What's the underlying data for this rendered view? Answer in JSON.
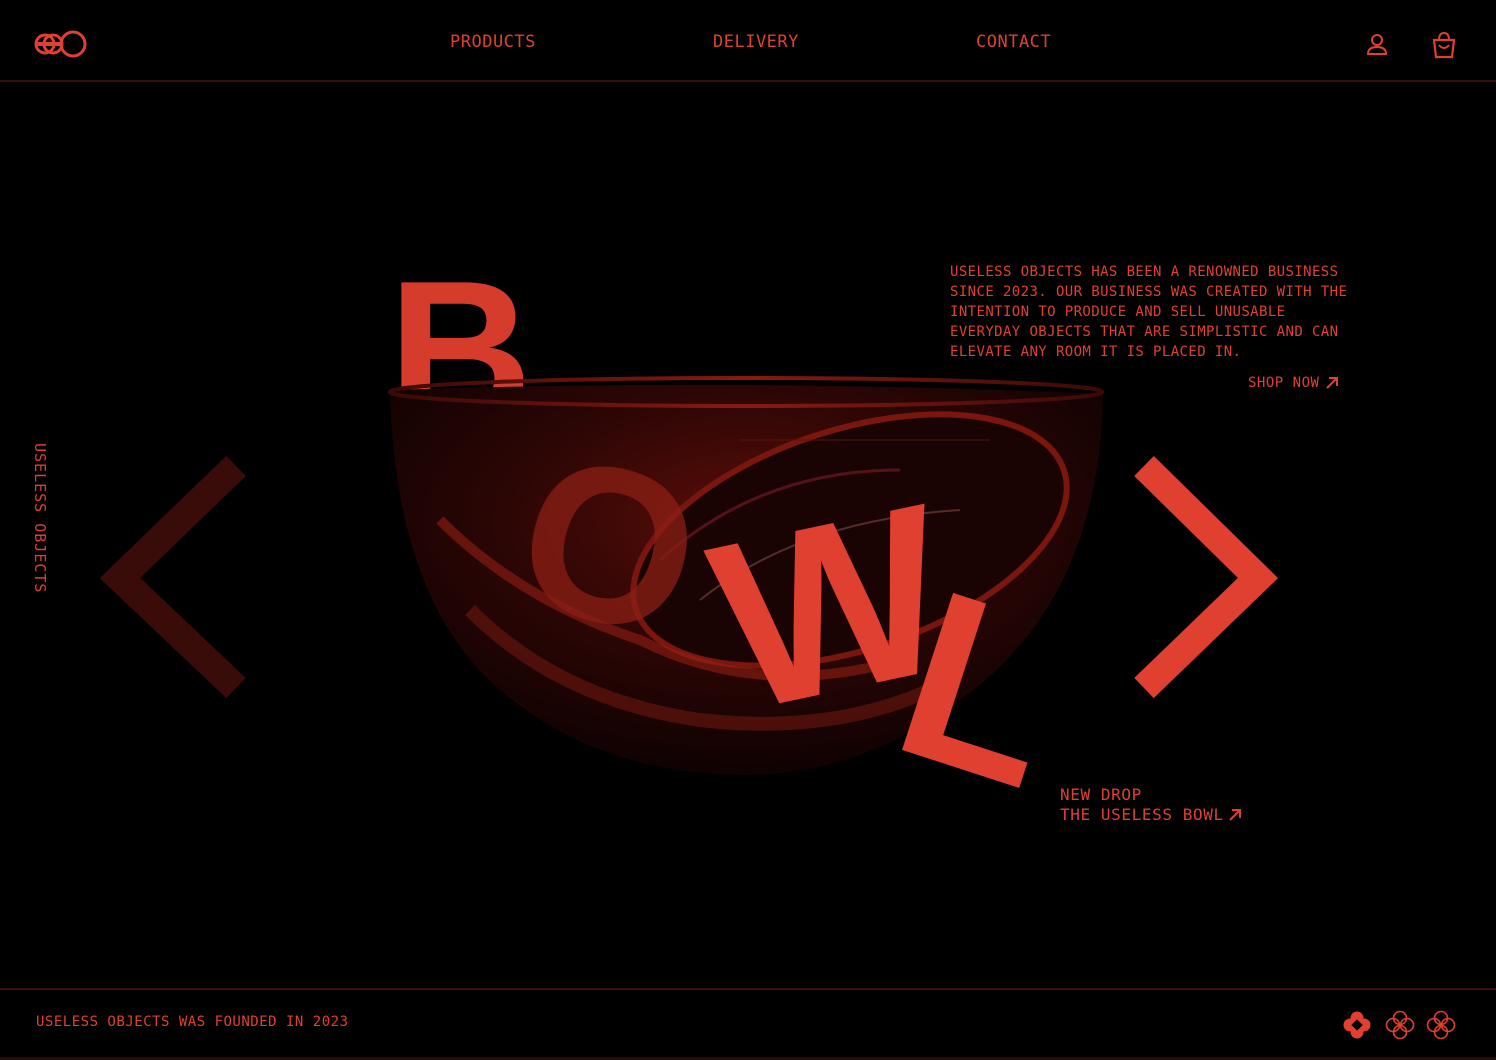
{
  "brand": {
    "logo_icon": "uo-logo",
    "vertical_text": "USELESS OBJECTS"
  },
  "nav": {
    "items": [
      {
        "label": "PRODUCTS"
      },
      {
        "label": "DELIVERY"
      },
      {
        "label": "CONTACT"
      }
    ],
    "account_icon": "user-icon",
    "cart_icon": "shopping-bag-icon"
  },
  "hero": {
    "title_letters": [
      "B",
      "O",
      "W",
      "L"
    ],
    "about_text": "USELESS OBJECTS HAS BEEN A RENOWNED BUSINESS SINCE 2023. OUR BUSINESS WAS CREATED WITH THE INTENTION TO PRODUCE AND SELL UNUSABLE EVERYDAY OBJECTS THAT ARE SIMPLISTIC AND CAN ELEVATE ANY ROOM IT IS PLACED IN.",
    "shop_now_label": "SHOP NOW",
    "new_drop_line1": "NEW DROP",
    "new_drop_line2": "THE USELESS BOWL",
    "prev_icon": "chevron-left-icon",
    "next_icon": "chevron-right-icon"
  },
  "footer": {
    "text": "USELESS OBJECTS WAS FOUNDED IN 2023",
    "pagination": {
      "count": 3,
      "active_index": 0
    }
  },
  "colors": {
    "background": "#000000",
    "accent": "#e0402f",
    "accent_dim": "#3a0f0b"
  }
}
